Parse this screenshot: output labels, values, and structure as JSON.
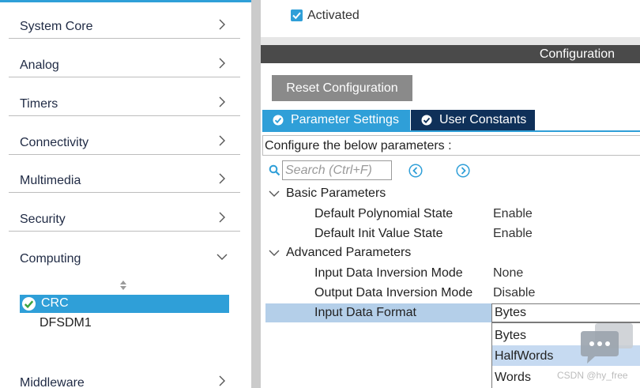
{
  "sidebar": {
    "categories": [
      {
        "label": "System Core",
        "expanded": false
      },
      {
        "label": "Analog",
        "expanded": false
      },
      {
        "label": "Timers",
        "expanded": false
      },
      {
        "label": "Connectivity",
        "expanded": false
      },
      {
        "label": "Multimedia",
        "expanded": false
      },
      {
        "label": "Security",
        "expanded": false
      },
      {
        "label": "Computing",
        "expanded": true
      },
      {
        "label": "Middleware",
        "expanded": false
      }
    ],
    "computing_items": [
      {
        "label": "CRC",
        "selected": true,
        "icon": "check-circle-icon"
      },
      {
        "label": "DFSDM1",
        "selected": false
      }
    ],
    "icons": {
      "collapsed": "chevron-right-icon",
      "expanded": "chevron-down-icon",
      "sort": "sort-arrows-icon"
    }
  },
  "main": {
    "activated": {
      "label": "Activated",
      "checked": true
    },
    "section_title": "Configuration",
    "reset_button": "Reset Configuration",
    "tabs": [
      {
        "label": "Parameter Settings",
        "active": true,
        "icon": "check-circle-icon"
      },
      {
        "label": "User Constants",
        "active": false,
        "icon": "check-circle-icon"
      }
    ],
    "configure_note": "Configure the below parameters :",
    "search": {
      "placeholder": "Search (Ctrl+F)",
      "value": ""
    },
    "groups": [
      {
        "label": "Basic Parameters",
        "params": [
          {
            "name": "Default Polynomial State",
            "value": "Enable"
          },
          {
            "name": "Default Init Value State",
            "value": "Enable"
          }
        ]
      },
      {
        "label": "Advanced Parameters",
        "params": [
          {
            "name": "Input Data Inversion Mode",
            "value": "None"
          },
          {
            "name": "Output Data Inversion Mode",
            "value": "Disable"
          },
          {
            "name": "Input Data Format",
            "value": "Bytes",
            "selected": true
          }
        ]
      }
    ],
    "dropdown": {
      "selected": "Bytes",
      "options": [
        "Bytes",
        "HalfWords",
        "Words"
      ],
      "highlighted": "HalfWords"
    }
  },
  "colors": {
    "accent": "#2f9fd8",
    "dark_tab": "#0f3059",
    "bar": "#4a4a4a",
    "selected_row": "#b4cfe9"
  },
  "watermark": "CSDN @hy_free"
}
